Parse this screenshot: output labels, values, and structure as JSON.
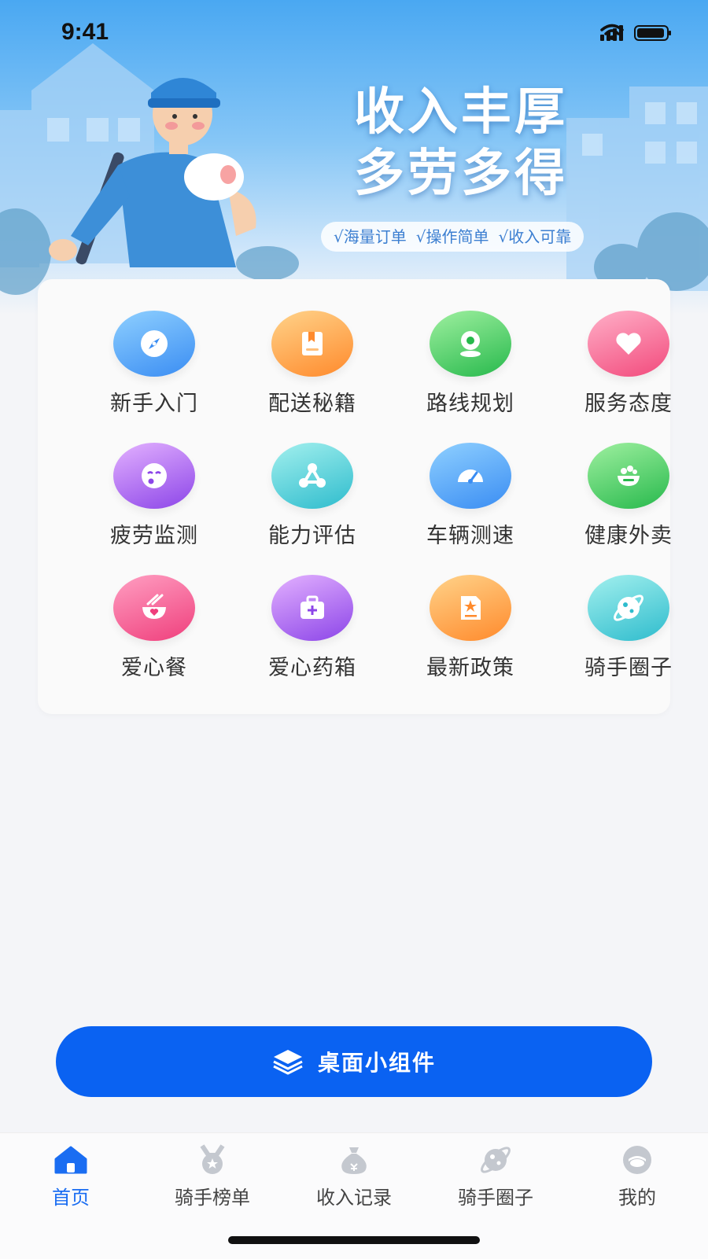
{
  "status_bar": {
    "time": "9:41"
  },
  "banner": {
    "slogan_line1": "收入丰厚",
    "slogan_line2": "多劳多得",
    "tags": [
      "√海量订单",
      "√操作简单",
      "√收入可靠"
    ]
  },
  "features": [
    {
      "label": "新手入门",
      "icon": "compass-icon"
    },
    {
      "label": "配送秘籍",
      "icon": "book-icon"
    },
    {
      "label": "路线规划",
      "icon": "location-pin-icon"
    },
    {
      "label": "服务态度",
      "icon": "heart-icon"
    },
    {
      "label": "疲劳监测",
      "icon": "tired-face-icon"
    },
    {
      "label": "能力评估",
      "icon": "network-icon"
    },
    {
      "label": "车辆测速",
      "icon": "speedometer-icon"
    },
    {
      "label": "健康外卖",
      "icon": "food-bowl-icon"
    },
    {
      "label": "爱心餐",
      "icon": "heart-bowl-icon"
    },
    {
      "label": "爱心药箱",
      "icon": "medicine-box-icon"
    },
    {
      "label": "最新政策",
      "icon": "policy-document-icon"
    },
    {
      "label": "骑手圈子",
      "icon": "planet-icon"
    }
  ],
  "widget_button": {
    "label": "桌面小组件",
    "icon": "layers-icon"
  },
  "tab_bar": {
    "active": "首页",
    "items": [
      {
        "label": "首页",
        "icon": "home-icon"
      },
      {
        "label": "骑手榜单",
        "icon": "medal-icon"
      },
      {
        "label": "收入记录",
        "icon": "money-bag-icon"
      },
      {
        "label": "骑手圈子",
        "icon": "planet-icon"
      },
      {
        "label": "我的",
        "icon": "profile-icon"
      }
    ]
  },
  "colors": {
    "primary": "#0a62f2",
    "tab_active": "#1a6df2",
    "background": "#f4f5f8"
  }
}
